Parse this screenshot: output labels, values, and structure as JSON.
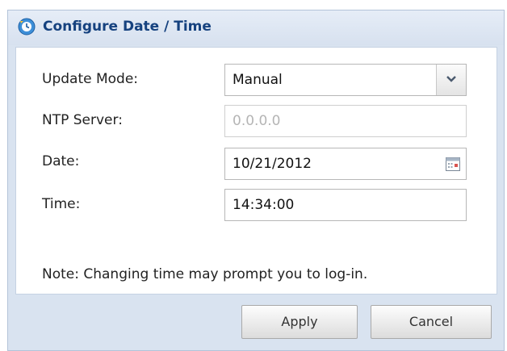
{
  "dialog": {
    "title": "Configure Date / Time",
    "icon": "clock-refresh-icon"
  },
  "form": {
    "update_mode": {
      "label": "Update Mode:",
      "value": "Manual"
    },
    "ntp_server": {
      "label": "NTP Server:",
      "value": "0.0.0.0"
    },
    "date": {
      "label": "Date:",
      "value": "10/21/2012"
    },
    "time": {
      "label": "Time:",
      "value": "14:34:00"
    },
    "note": "Note: Changing time may prompt you to log-in."
  },
  "buttons": {
    "apply": "Apply",
    "cancel": "Cancel"
  },
  "colors": {
    "title_text": "#16427f",
    "dialog_bg": "#d9e3f0",
    "panel_bg": "#ffffff",
    "disabled_text": "#b5b5b5"
  }
}
